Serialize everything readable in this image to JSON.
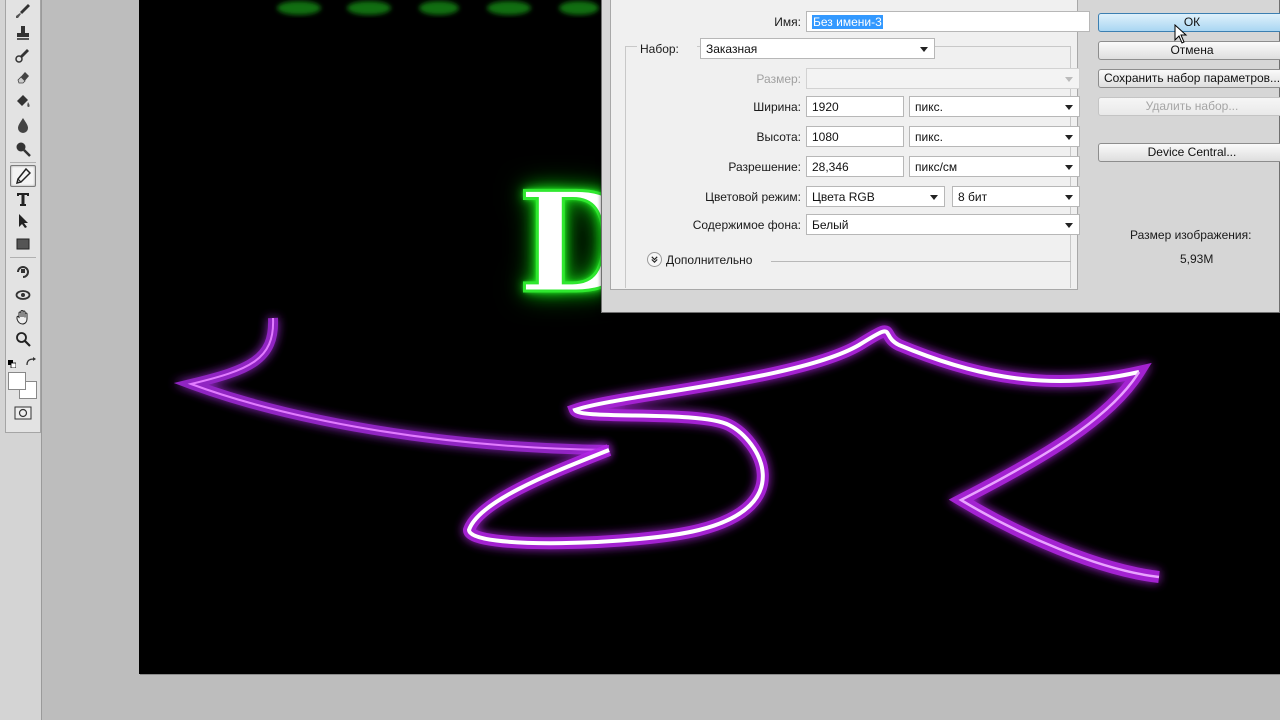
{
  "dialog": {
    "name_label": "Имя:",
    "name_value": "Без имени-3",
    "preset_label": "Набор:",
    "preset_value": "Заказная",
    "size_label": "Размер:",
    "size_value": "",
    "width_label": "Ширина:",
    "width_value": "1920",
    "width_unit": "пикс.",
    "height_label": "Высота:",
    "height_value": "1080",
    "height_unit": "пикс.",
    "resolution_label": "Разрешение:",
    "resolution_value": "28,346",
    "resolution_unit": "пикс/см",
    "color_mode_label": "Цветовой режим:",
    "color_mode_value": "Цвета RGB",
    "bit_depth_value": "8 бит",
    "background_label": "Содержимое фона:",
    "background_value": "Белый",
    "advanced_label": "Дополнительно",
    "buttons": {
      "ok": "ОК",
      "cancel": "Отмена",
      "save_preset": "Сохранить набор параметров...",
      "delete_preset": "Удалить набор...",
      "device_central": "Device Central..."
    },
    "image_size_label": "Размер изображения:",
    "image_size_value": "5,93M"
  },
  "canvas": {
    "letter": "D",
    "neon_colors": {
      "text_glow": "#22ee22",
      "line_glow": "#b022e0",
      "line_core": "#ffffff"
    }
  },
  "tools": [
    "brush-icon",
    "clone-stamp-icon",
    "history-brush-icon",
    "eraser-icon",
    "paint-bucket-icon",
    "blur-icon",
    "dodge-icon",
    "pen-icon",
    "type-icon",
    "path-selection-icon",
    "rectangle-shape-icon",
    "3d-rotate-icon",
    "3d-orbit-icon",
    "hand-icon",
    "zoom-icon"
  ],
  "colors": {
    "foreground": "#ffffff",
    "background": "#ffffff",
    "accent": "#3399ff"
  }
}
